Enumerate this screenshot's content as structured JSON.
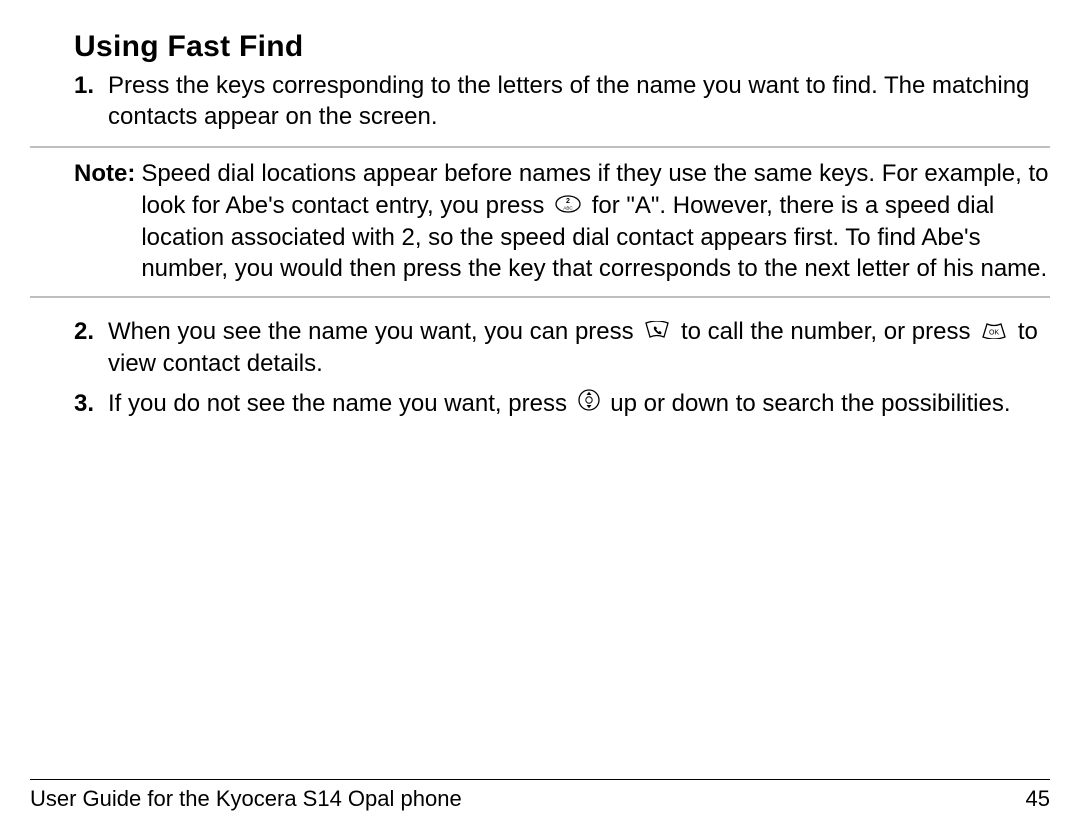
{
  "heading": "Using Fast Find",
  "steps": {
    "s1": {
      "num": "1.",
      "text": "Press the keys corresponding to the letters of the name you want to find. The matching contacts appear on the screen."
    },
    "s2": {
      "num": "2.",
      "a": "When you see the name you want, you can press ",
      "b": " to call the number, or press ",
      "c": " to view contact details."
    },
    "s3": {
      "num": "3.",
      "a": "If you do not see the name you want, press ",
      "b": " up or down to search the possibilities."
    }
  },
  "note": {
    "label": "Note:",
    "a": "Speed dial locations appear before names if they use the same keys. For example, to look for Abe's contact entry, you press ",
    "b": " for \"A\". However, there is a speed dial location associated with 2, so the speed dial contact appears first. To find Abe's number, you would then press the key that corresponds to the next letter of his name."
  },
  "footer": {
    "title": "User Guide for the Kyocera S14 Opal phone",
    "page": "45"
  },
  "icons": {
    "key2": "2-abc-key-icon",
    "call": "call-key-icon",
    "ok": "ok-key-icon",
    "nav": "nav-updown-key-icon"
  }
}
